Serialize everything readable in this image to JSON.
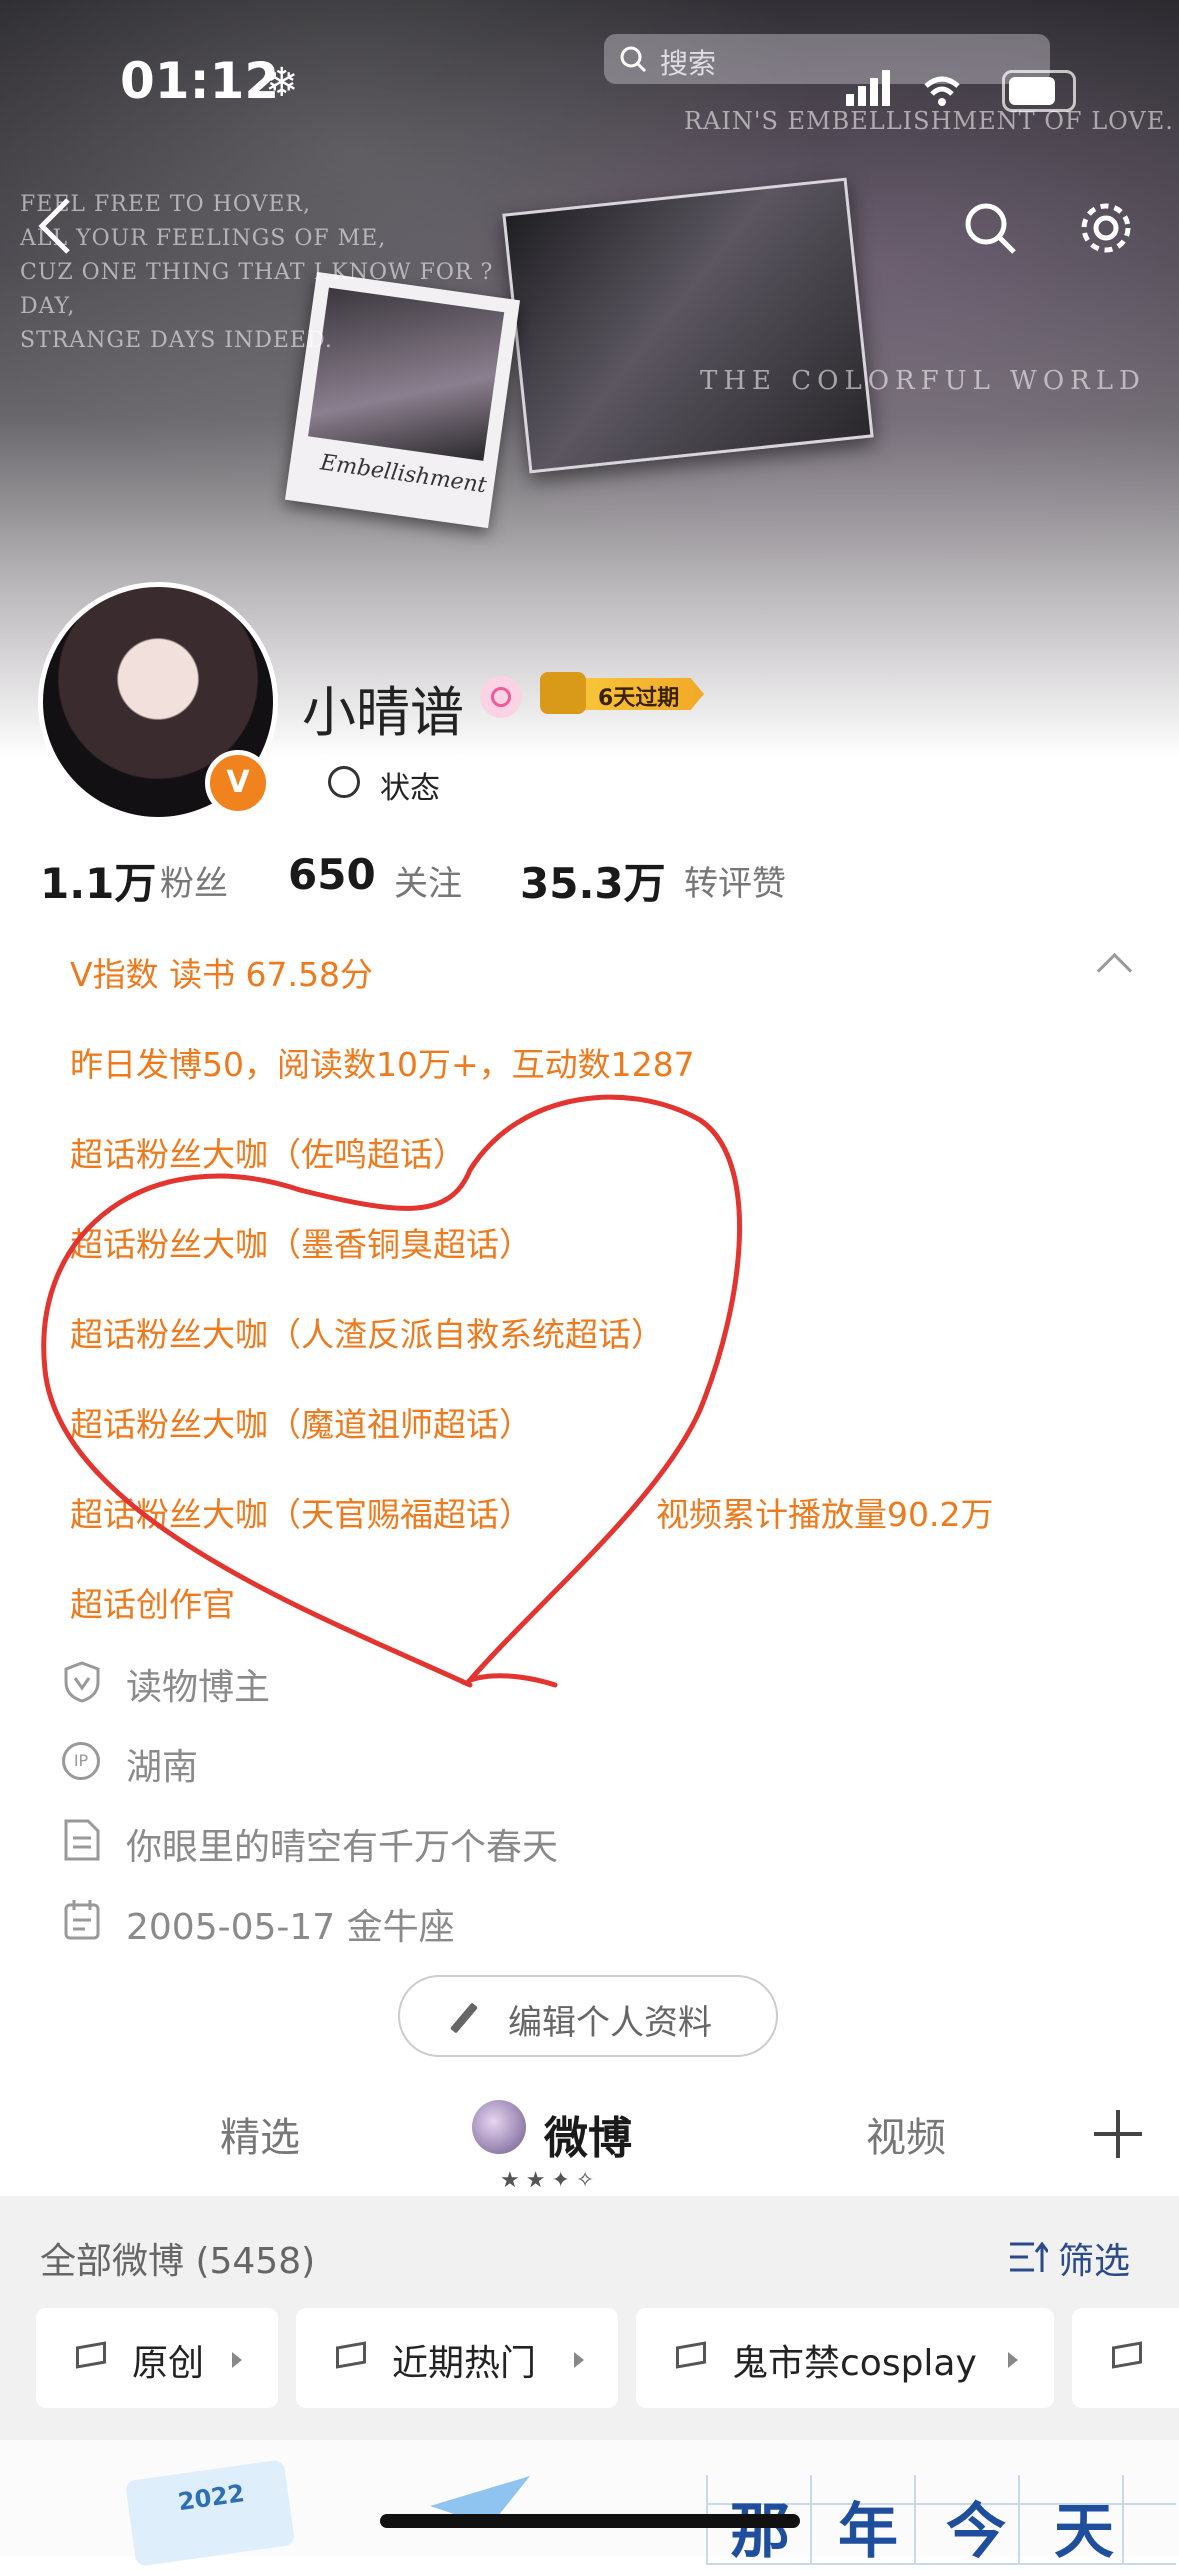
{
  "status_bar": {
    "time": "01:12",
    "snow_glyph": "❄"
  },
  "header": {
    "search_placeholder": "搜索",
    "banner_lines": [
      "FEEL FREE TO HOVER,",
      "ALL YOUR FEELINGS OF ME,",
      "CUZ ONE THING THAT I KNOW FOR ?",
      "DAY,",
      "STRANGE DAYS INDEED."
    ],
    "banner_title": "RAIN'S EMBELLISHMENT OF LOVE.",
    "banner_subtitle": "THE COLORFUL WORLD",
    "polaroid_caption": "Embellishment"
  },
  "profile": {
    "name": "小晴谱",
    "vip_label": "6天过期",
    "status_button": "状态",
    "verified_glyph": "V"
  },
  "stats": [
    {
      "num": "1.1万",
      "label": "粉丝"
    },
    {
      "num": "650",
      "label": "关注"
    },
    {
      "num": "35.3万",
      "label": "转评赞"
    }
  ],
  "info": {
    "v_index": "V指数 读书 67.58分",
    "lines": [
      "昨日发博50，阅读数10万+，互动数1287",
      "超话粉丝大咖（佐鸣超话）",
      "超话粉丝大咖（墨香铜臭超话）",
      "超话粉丝大咖（人渣反派自救系统超话）",
      "超话粉丝大咖（魔道祖师超话）",
      "超话粉丝大咖（天官赐福超话）",
      "超话创作官"
    ],
    "video_stat": "视频累计播放量90.2万",
    "role": "读物博主",
    "ip": "湖南",
    "bio": "你眼里的晴空有千万个春天",
    "birthday": "2005-05-17 金牛座",
    "ip_icon_text": "IP"
  },
  "edit_button": "编辑个人资料",
  "tabs": [
    "精选",
    "微博",
    "视频"
  ],
  "feed": {
    "all_label": "全部微博 (5458)",
    "filter_label": "筛选",
    "chips": [
      "原创",
      "近期热门",
      "鬼市禁cosplay"
    ]
  },
  "promo": {
    "calendar_year": "2022",
    "grid_chars": [
      "那",
      "年",
      "今",
      "天"
    ]
  },
  "colors": {
    "accent_orange": "#ee7a1e",
    "filter_blue": "#2a4a8a",
    "annotation_red": "#e3342f"
  }
}
